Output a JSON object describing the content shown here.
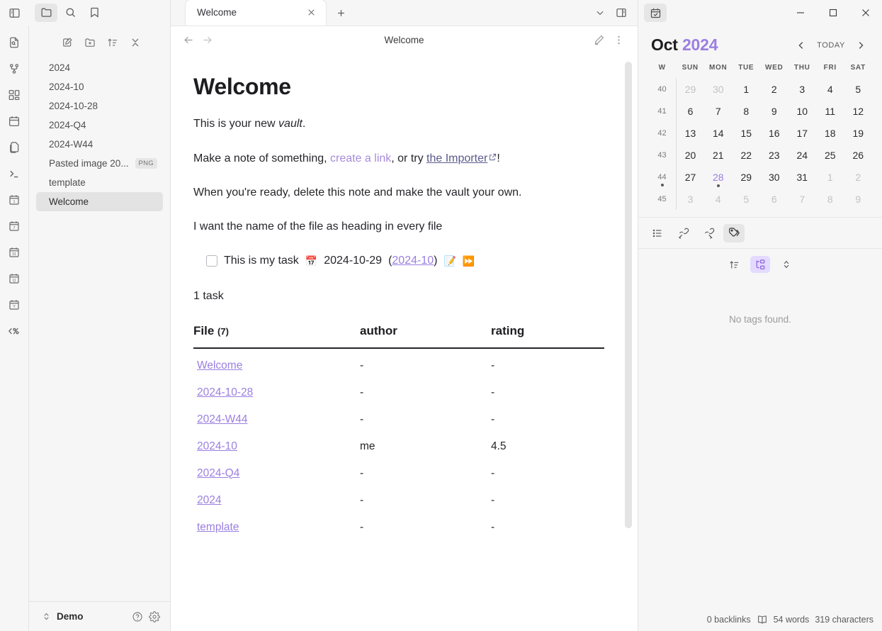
{
  "rail": {
    "top_icon": "sidebar-toggle-icon",
    "icons": [
      {
        "name": "file-search-icon"
      },
      {
        "name": "graph-view-icon"
      },
      {
        "name": "canvas-icon"
      },
      {
        "name": "calendar-icon"
      },
      {
        "name": "copy-files-icon"
      },
      {
        "name": "terminal-icon"
      },
      {
        "name": "daily-note-icon",
        "glyph": "1"
      },
      {
        "name": "weekly-note-icon",
        "glyph": "7"
      },
      {
        "name": "monthly-note-icon",
        "glyph": "31"
      },
      {
        "name": "quarterly-note-icon",
        "glyph": "Q"
      },
      {
        "name": "yearly-note-icon",
        "glyph": "Y"
      },
      {
        "name": "templater-icon",
        "glyph": "<%"
      }
    ]
  },
  "sidebar": {
    "tabs": [
      {
        "name": "files-tab",
        "label": "Files",
        "active": true
      },
      {
        "name": "search-tab",
        "label": "Search",
        "active": false
      },
      {
        "name": "bookmarks-tab",
        "label": "Bookmarks",
        "active": false
      }
    ],
    "toolbar": [
      {
        "name": "new-note-button",
        "label": "New note"
      },
      {
        "name": "new-folder-button",
        "label": "New folder"
      },
      {
        "name": "sort-order-button",
        "label": "Change sort order"
      },
      {
        "name": "collapse-all-button",
        "label": "Collapse all"
      }
    ],
    "files": [
      {
        "label": "2024",
        "badge": "",
        "selected": false
      },
      {
        "label": "2024-10",
        "badge": "",
        "selected": false
      },
      {
        "label": "2024-10-28",
        "badge": "",
        "selected": false
      },
      {
        "label": "2024-Q4",
        "badge": "",
        "selected": false
      },
      {
        "label": "2024-W44",
        "badge": "",
        "selected": false
      },
      {
        "label": "Pasted image 20...",
        "badge": "PNG",
        "selected": false
      },
      {
        "label": "template",
        "badge": "",
        "selected": false
      },
      {
        "label": "Welcome",
        "badge": "",
        "selected": true
      }
    ],
    "footer": {
      "vault_name": "Demo",
      "help_label": "Help",
      "settings_label": "Settings"
    }
  },
  "editor": {
    "tab": {
      "title": "Welcome",
      "close_label": "Close"
    },
    "new_tab_label": "New tab",
    "tab_list_label": "Tab list",
    "right_sidebar_toggle_label": "Toggle right sidebar",
    "header": {
      "back_label": "Back",
      "forward_label": "Forward",
      "title": "Welcome",
      "edit_label": "Edit",
      "more_label": "More options"
    },
    "doc": {
      "heading": "Welcome",
      "p1_pre": "This is your new ",
      "p1_em": "vault",
      "p1_post": ".",
      "p2_pre": "Make a note of something, ",
      "p2_link1": "create a link",
      "p2_mid": ", or try ",
      "p2_link2": "the Importer",
      "p2_post": "!",
      "p3": "When you're ready, delete this note and make the vault your own.",
      "p4": "I want the name of the file as heading in every file",
      "task": {
        "text": "This is my task",
        "date_icon": "calendar-emoji",
        "date": "2024-10-29",
        "link_open": "(",
        "link": "2024-10",
        "link_close": ")",
        "edit_emoji": "memo-emoji",
        "forward_emoji": "fast-forward-emoji"
      },
      "task_count": "1 task",
      "table": {
        "columns": [
          "File",
          "author",
          "rating"
        ],
        "file_count": "(7)",
        "rows": [
          {
            "file": "Welcome",
            "author": "-",
            "rating": "-"
          },
          {
            "file": "2024-10-28",
            "author": "-",
            "rating": "-"
          },
          {
            "file": "2024-W44",
            "author": "-",
            "rating": "-"
          },
          {
            "file": "2024-10",
            "author": "me",
            "rating": "4.5"
          },
          {
            "file": "2024-Q4",
            "author": "-",
            "rating": "-"
          },
          {
            "file": "2024",
            "author": "-",
            "rating": "-"
          },
          {
            "file": "template",
            "author": "-",
            "rating": "-"
          }
        ]
      }
    }
  },
  "window": {
    "app_icon": "calendar-check-icon",
    "minimize_label": "Minimize",
    "maximize_label": "Maximize",
    "close_label": "Close"
  },
  "calendar": {
    "month": "Oct",
    "year": "2024",
    "prev_label": "Previous month",
    "today_label": "TODAY",
    "next_label": "Next month",
    "day_headers": [
      "W",
      "SUN",
      "MON",
      "TUE",
      "WED",
      "THU",
      "FRI",
      "SAT"
    ],
    "weeks": [
      {
        "w": "40",
        "w_dot": false,
        "days": [
          {
            "n": "29",
            "adj": true
          },
          {
            "n": "30",
            "adj": true
          },
          {
            "n": "1"
          },
          {
            "n": "2"
          },
          {
            "n": "3"
          },
          {
            "n": "4"
          },
          {
            "n": "5"
          }
        ]
      },
      {
        "w": "41",
        "w_dot": false,
        "days": [
          {
            "n": "6"
          },
          {
            "n": "7"
          },
          {
            "n": "8"
          },
          {
            "n": "9"
          },
          {
            "n": "10"
          },
          {
            "n": "11"
          },
          {
            "n": "12"
          }
        ]
      },
      {
        "w": "42",
        "w_dot": false,
        "days": [
          {
            "n": "13"
          },
          {
            "n": "14"
          },
          {
            "n": "15"
          },
          {
            "n": "16"
          },
          {
            "n": "17"
          },
          {
            "n": "18"
          },
          {
            "n": "19"
          }
        ]
      },
      {
        "w": "43",
        "w_dot": false,
        "days": [
          {
            "n": "20"
          },
          {
            "n": "21"
          },
          {
            "n": "22"
          },
          {
            "n": "23"
          },
          {
            "n": "24"
          },
          {
            "n": "25"
          },
          {
            "n": "26"
          }
        ]
      },
      {
        "w": "44",
        "w_dot": true,
        "days": [
          {
            "n": "27"
          },
          {
            "n": "28",
            "today": true,
            "dot": true
          },
          {
            "n": "29"
          },
          {
            "n": "30"
          },
          {
            "n": "31"
          },
          {
            "n": "1",
            "adj": true
          },
          {
            "n": "2",
            "adj": true
          }
        ]
      },
      {
        "w": "45",
        "w_dot": false,
        "days": [
          {
            "n": "3",
            "adj": true
          },
          {
            "n": "4",
            "adj": true
          },
          {
            "n": "5",
            "adj": true
          },
          {
            "n": "6",
            "adj": true
          },
          {
            "n": "7",
            "adj": true
          },
          {
            "n": "8",
            "adj": true
          },
          {
            "n": "9",
            "adj": true
          }
        ]
      }
    ]
  },
  "side_panel": {
    "tabs": [
      {
        "name": "outline-tab",
        "label": "Outline",
        "active": false
      },
      {
        "name": "backlinks-tab",
        "label": "Backlinks",
        "active": false
      },
      {
        "name": "outgoing-links-tab",
        "label": "Outgoing links",
        "active": false
      },
      {
        "name": "tags-tab",
        "label": "Tags",
        "active": true
      }
    ],
    "tag_tools": [
      {
        "name": "sort-tags-button",
        "label": "Change sort order",
        "active": false
      },
      {
        "name": "nested-tags-button",
        "label": "Show nested tags",
        "active": true
      },
      {
        "name": "collapse-tags-button",
        "label": "Collapse/expand",
        "active": false
      }
    ],
    "empty_message": "No tags found."
  },
  "status_bar": {
    "backlinks": "0 backlinks",
    "reading_icon": "book-icon",
    "words": "54 words",
    "characters": "319 characters"
  },
  "colors": {
    "accent_purple": "#9b7fe0",
    "internal_link": "#a78bda",
    "panel_bg": "#f6f6f6",
    "editor_bg": "#ffffff",
    "border": "#e3e3e3"
  }
}
